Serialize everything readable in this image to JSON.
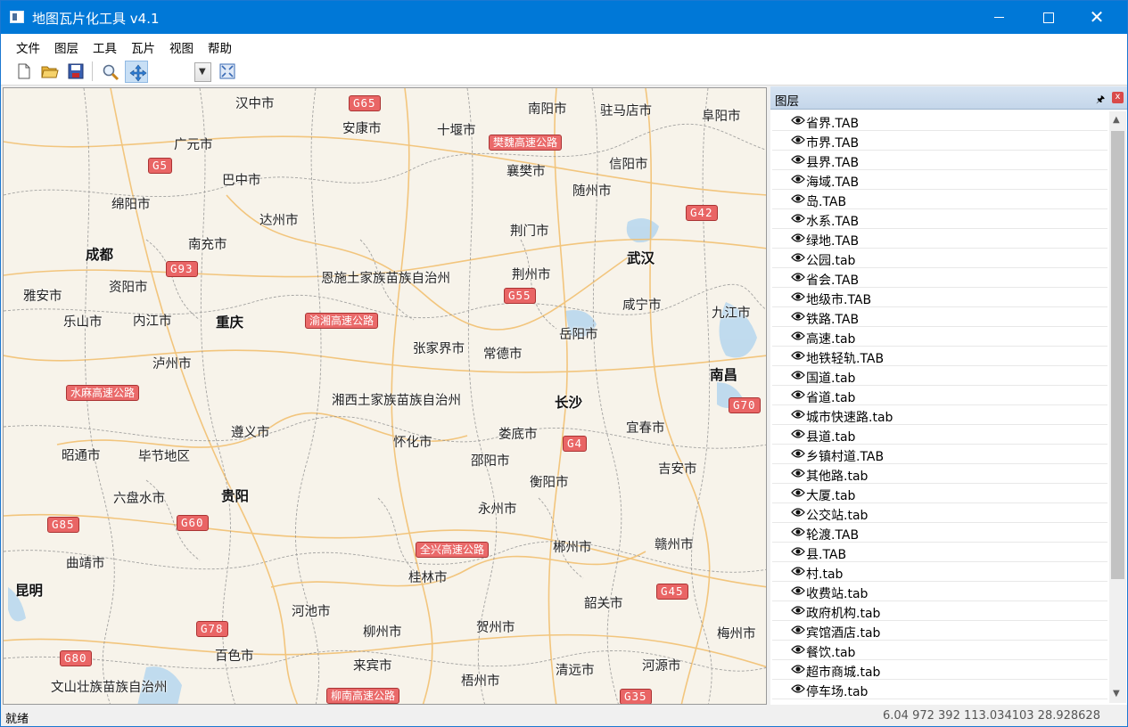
{
  "window": {
    "title": "地图瓦片化工具 v4.1",
    "minimize": "—",
    "maximize": "☐",
    "close": "✕"
  },
  "menu": [
    "文件",
    "图层",
    "工具",
    "瓦片",
    "视图",
    "帮助"
  ],
  "toolbar": {
    "buttons": [
      "new-file-icon",
      "open-folder-icon",
      "save-icon",
      "zoom-icon",
      "pan-icon",
      "full-extent-icon"
    ],
    "active_tool": "pan-icon",
    "combo_value": ""
  },
  "map": {
    "cities": [
      {
        "name": "汉中市",
        "capital": false
      },
      {
        "name": "安康市",
        "capital": false
      },
      {
        "name": "十堰市",
        "capital": false
      },
      {
        "name": "南阳市",
        "capital": false
      },
      {
        "name": "驻马店市",
        "capital": false
      },
      {
        "name": "阜阳市",
        "capital": false
      },
      {
        "name": "广元市",
        "capital": false
      },
      {
        "name": "巴中市",
        "capital": false
      },
      {
        "name": "襄樊市",
        "capital": false
      },
      {
        "name": "信阳市",
        "capital": false
      },
      {
        "name": "随州市",
        "capital": false
      },
      {
        "name": "绵阳市",
        "capital": false
      },
      {
        "name": "达州市",
        "capital": false
      },
      {
        "name": "荆门市",
        "capital": false
      },
      {
        "name": "成都",
        "capital": true
      },
      {
        "name": "南充市",
        "capital": false
      },
      {
        "name": "武汉",
        "capital": true
      },
      {
        "name": "荆州市",
        "capital": false
      },
      {
        "name": "恩施土家族苗族自治州",
        "capital": false
      },
      {
        "name": "资阳市",
        "capital": false
      },
      {
        "name": "雅安市",
        "capital": false
      },
      {
        "name": "咸宁市",
        "capital": false
      },
      {
        "name": "九江市",
        "capital": false
      },
      {
        "name": "乐山市",
        "capital": false
      },
      {
        "name": "内江市",
        "capital": false
      },
      {
        "name": "重庆",
        "capital": true
      },
      {
        "name": "岳阳市",
        "capital": false
      },
      {
        "name": "张家界市",
        "capital": false
      },
      {
        "name": "常德市",
        "capital": false
      },
      {
        "name": "泸州市",
        "capital": false
      },
      {
        "name": "南昌",
        "capital": true
      },
      {
        "name": "湘西土家族苗族自治州",
        "capital": false
      },
      {
        "name": "长沙",
        "capital": true
      },
      {
        "name": "遵义市",
        "capital": false
      },
      {
        "name": "宜春市",
        "capital": false
      },
      {
        "name": "娄底市",
        "capital": false
      },
      {
        "name": "怀化市",
        "capital": false
      },
      {
        "name": "昭通市",
        "capital": false
      },
      {
        "name": "毕节地区",
        "capital": false
      },
      {
        "name": "邵阳市",
        "capital": false
      },
      {
        "name": "吉安市",
        "capital": false
      },
      {
        "name": "衡阳市",
        "capital": false
      },
      {
        "name": "六盘水市",
        "capital": false
      },
      {
        "name": "贵阳",
        "capital": true
      },
      {
        "name": "永州市",
        "capital": false
      },
      {
        "name": "郴州市",
        "capital": false
      },
      {
        "name": "赣州市",
        "capital": false
      },
      {
        "name": "曲靖市",
        "capital": false
      },
      {
        "name": "桂林市",
        "capital": false
      },
      {
        "name": "昆明",
        "capital": true
      },
      {
        "name": "韶关市",
        "capital": false
      },
      {
        "name": "河池市",
        "capital": false
      },
      {
        "name": "贺州市",
        "capital": false
      },
      {
        "name": "柳州市",
        "capital": false
      },
      {
        "name": "梅州市",
        "capital": false
      },
      {
        "name": "百色市",
        "capital": false
      },
      {
        "name": "来宾市",
        "capital": false
      },
      {
        "name": "清远市",
        "capital": false
      },
      {
        "name": "河源市",
        "capital": false
      },
      {
        "name": "文山壮族苗族自治州",
        "capital": false
      },
      {
        "name": "梧州市",
        "capital": false
      }
    ],
    "shields": [
      {
        "text": "G65",
        "type": "code"
      },
      {
        "text": "樊魏高速公路",
        "type": "name"
      },
      {
        "text": "G5",
        "type": "code"
      },
      {
        "text": "G42",
        "type": "code"
      },
      {
        "text": "G93",
        "type": "code"
      },
      {
        "text": "G55",
        "type": "code"
      },
      {
        "text": "渝湘高速公路",
        "type": "name"
      },
      {
        "text": "水麻高速公路",
        "type": "name"
      },
      {
        "text": "G70",
        "type": "code"
      },
      {
        "text": "G4",
        "type": "code"
      },
      {
        "text": "G85",
        "type": "code"
      },
      {
        "text": "G60",
        "type": "code"
      },
      {
        "text": "全兴高速公路",
        "type": "name"
      },
      {
        "text": "G45",
        "type": "code"
      },
      {
        "text": "G78",
        "type": "code"
      },
      {
        "text": "G80",
        "type": "code"
      },
      {
        "text": "柳南高速公路",
        "type": "name"
      },
      {
        "text": "G35",
        "type": "code"
      }
    ]
  },
  "layers_panel": {
    "title": "图层",
    "pin": "🖈",
    "close": "x",
    "layers": [
      "省界.TAB",
      "市界.TAB",
      "县界.TAB",
      "海域.TAB",
      "岛.TAB",
      "水系.TAB",
      "绿地.TAB",
      "公园.tab",
      "省会.TAB",
      "地级市.TAB",
      "铁路.TAB",
      "高速.tab",
      "地铁轻轨.TAB",
      "国道.tab",
      "省道.tab",
      "城市快速路.tab",
      "县道.tab",
      "乡镇村道.TAB",
      "其他路.tab",
      "大厦.tab",
      "公交站.tab",
      "轮渡.TAB",
      "县.TAB",
      "村.tab",
      "收费站.tab",
      "政府机构.tab",
      "宾馆酒店.tab",
      "餐饮.tab",
      "超市商城.tab",
      "停车场.tab"
    ]
  },
  "status": {
    "text": "就绪",
    "coords": "6.04 972 392 113.034103 28.928628"
  }
}
